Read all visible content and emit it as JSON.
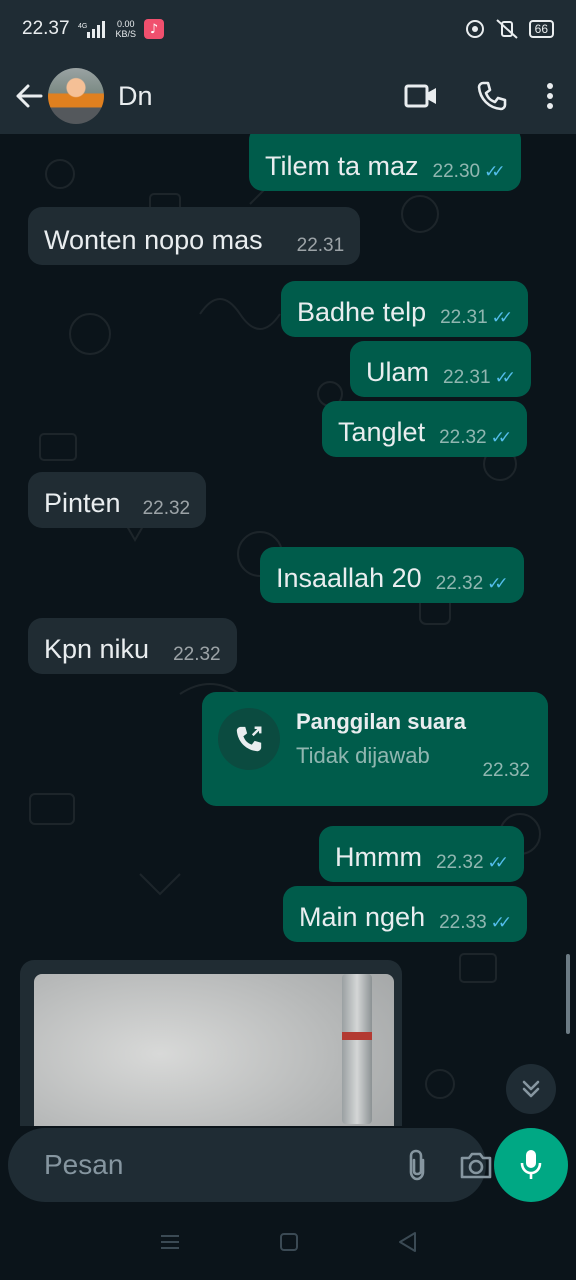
{
  "status_bar": {
    "time": "22.37",
    "network_speed": "0.00",
    "network_unit": "KB/S",
    "network_type": "4G",
    "battery": "66",
    "icons": [
      "signal-icon",
      "music-app-icon",
      "alarm-icon",
      "mute-icon",
      "battery-icon"
    ]
  },
  "header": {
    "contact_name": "Dn",
    "icons": [
      "back-arrow-icon",
      "video-call-icon",
      "phone-icon",
      "more-options-icon"
    ]
  },
  "messages": [
    {
      "direction": "out",
      "text": "Tilem ta maz",
      "time": "22.30",
      "read": true
    },
    {
      "direction": "in",
      "text": "Wonten nopo mas",
      "time": "22.31"
    },
    {
      "direction": "out",
      "text": "Badhe telp",
      "time": "22.31",
      "read": true
    },
    {
      "direction": "out",
      "text": "Ulam",
      "time": "22.31",
      "read": true
    },
    {
      "direction": "out",
      "text": "Tanglet",
      "time": "22.32",
      "read": true
    },
    {
      "direction": "in",
      "text": "Pinten",
      "time": "22.32"
    },
    {
      "direction": "out",
      "text": "Insaallah 20",
      "time": "22.32",
      "read": true
    },
    {
      "direction": "in",
      "text": "Kpn niku",
      "time": "22.32"
    },
    {
      "direction": "out",
      "text": "Hmmm",
      "time": "22.32",
      "read": true
    },
    {
      "direction": "out",
      "text": "Main ngeh",
      "time": "22.33",
      "read": true
    }
  ],
  "call": {
    "title": "Panggilan suara",
    "subtitle": "Tidak dijawab",
    "time": "22.32"
  },
  "input": {
    "placeholder": "Pesan"
  },
  "colors": {
    "background": "#0b141a",
    "outgoing_bubble": "#005c4b",
    "incoming_bubble": "#202c33",
    "header": "#1f2c34",
    "accent": "#00a884",
    "read_ticks": "#53bdeb"
  }
}
